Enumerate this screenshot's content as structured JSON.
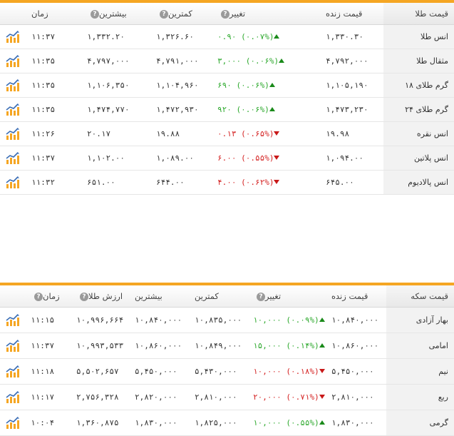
{
  "gold": {
    "headers": {
      "name": "قیمت طلا",
      "live": "قیمت زنده",
      "change": "تغییر",
      "low": "کمترین",
      "high": "بیشترین",
      "time": "زمان"
    },
    "help_glyph": "?",
    "rows": [
      {
        "name": "انس طلا",
        "live": "۱,۳۳۰.۳۰",
        "change": "۰.۹۰ (۰.۰۷%)",
        "dir": "up",
        "low": "۱,۳۲۶.۶۰",
        "high": "۱,۳۳۲.۲۰",
        "time": "۱۱:۳۷"
      },
      {
        "name": "مثقال طلا",
        "live": "۴,۷۹۲,۰۰۰",
        "change": "۳,۰۰۰ (۰.۰۶%)",
        "dir": "up",
        "low": "۴,۷۹۱,۰۰۰",
        "high": "۴,۷۹۷,۰۰۰",
        "time": "۱۱:۳۵"
      },
      {
        "name": "گرم طلای ۱۸",
        "live": "۱,۱۰۵,۱۹۰",
        "change": "۶۹۰ (۰.۰۶%)",
        "dir": "up",
        "low": "۱,۱۰۴,۹۶۰",
        "high": "۱,۱۰۶,۳۵۰",
        "time": "۱۱:۳۵"
      },
      {
        "name": "گرم طلای ۲۴",
        "live": "۱,۴۷۳,۲۳۰",
        "change": "۹۲۰ (۰.۰۶%)",
        "dir": "up",
        "low": "۱,۴۷۲,۹۳۰",
        "high": "۱,۴۷۴,۷۷۰",
        "time": "۱۱:۳۵"
      },
      {
        "name": "انس نقره",
        "live": "۱۹.۹۸",
        "change": "۰.۱۳ (۰.۶۵%)",
        "dir": "down",
        "low": "۱۹.۸۸",
        "high": "۲۰.۱۷",
        "time": "۱۱:۲۶"
      },
      {
        "name": "انس پلاتین",
        "live": "۱,۰۹۴.۰۰",
        "change": "۶.۰۰ (۰.۵۵%)",
        "dir": "down",
        "low": "۱,۰۸۹.۰۰",
        "high": "۱,۱۰۲.۰۰",
        "time": "۱۱:۳۷"
      },
      {
        "name": "انس پالادیوم",
        "live": "۶۴۵.۰۰",
        "change": "۴.۰۰ (۰.۶۲%)",
        "dir": "down",
        "low": "۶۴۴.۰۰",
        "high": "۶۵۱.۰۰",
        "time": "۱۱:۳۲"
      }
    ]
  },
  "coin": {
    "headers": {
      "name": "قیمت سکه",
      "live": "قیمت زنده",
      "change": "تغییر",
      "low": "کمترین",
      "high": "بیشترین",
      "value": "ارزش طلا",
      "time": "زمان"
    },
    "help_glyph": "?",
    "rows": [
      {
        "name": "بهار آزادی",
        "live": "۱۰,۸۴۰,۰۰۰",
        "change": "۱۰,۰۰۰ (۰.۰۹%)",
        "dir": "up",
        "low": "۱۰,۸۳۵,۰۰۰",
        "high": "۱۰,۸۴۰,۰۰۰",
        "value": "۱۰,۹۹۶,۶۶۴",
        "time": "۱۱:۱۵"
      },
      {
        "name": "امامی",
        "live": "۱۰,۸۶۰,۰۰۰",
        "change": "۱۵,۰۰۰ (۰.۱۴%)",
        "dir": "up",
        "low": "۱۰,۸۴۹,۰۰۰",
        "high": "۱۰,۸۶۰,۰۰۰",
        "value": "۱۰,۹۹۳,۵۳۳",
        "time": "۱۱:۳۷"
      },
      {
        "name": "نیم",
        "live": "۵,۴۵۰,۰۰۰",
        "change": "۱۰,۰۰۰ (۰.۱۸%)",
        "dir": "down",
        "low": "۵,۴۳۰,۰۰۰",
        "high": "۵,۴۵۰,۰۰۰",
        "value": "۵,۵۰۲,۶۵۷",
        "time": "۱۱:۱۸"
      },
      {
        "name": "ربع",
        "live": "۲,۸۱۰,۰۰۰",
        "change": "۲۰,۰۰۰ (۰.۷۱%)",
        "dir": "down",
        "low": "۲,۸۱۰,۰۰۰",
        "high": "۲,۸۲۰,۰۰۰",
        "value": "۲,۷۵۶,۳۲۸",
        "time": "۱۱:۱۷"
      },
      {
        "name": "گرمی",
        "live": "۱,۸۳۰,۰۰۰",
        "change": "۱۰,۰۰۰ (۰.۵۵%)",
        "dir": "up",
        "low": "۱,۸۲۵,۰۰۰",
        "high": "۱,۸۳۰,۰۰۰",
        "value": "۱,۳۶۰,۸۷۵",
        "time": "۱۰:۰۴"
      }
    ]
  },
  "icons": {
    "row_chart": "bar-chart-icon",
    "help": "question-circle-icon",
    "up": "triangle-up-icon",
    "down": "triangle-down-icon"
  },
  "colors": {
    "accent": "#f5a623",
    "up": "#2ba82b",
    "down": "#d42020"
  }
}
